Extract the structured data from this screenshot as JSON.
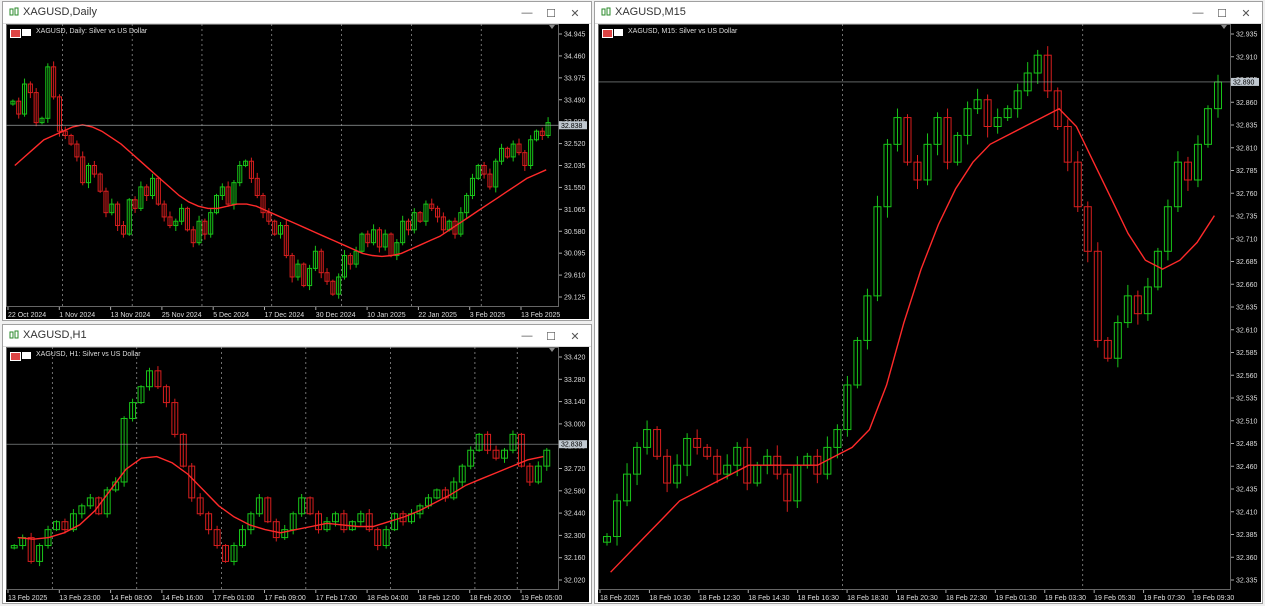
{
  "windows": [
    {
      "id": "daily",
      "title": "XAGUSD,Daily",
      "symbol_label": "XAGUSD, Daily: Silver vs US Dollar",
      "current_price": "32.838",
      "current_value": 32.838,
      "prices": [
        "34.945",
        "34.460",
        "33.975",
        "33.490",
        "33.005",
        "32.520",
        "32.035",
        "31.550",
        "31.065",
        "30.580",
        "30.095",
        "29.610",
        "29.125"
      ],
      "times": [
        "22 Oct 2024",
        "1 Nov 2024",
        "13 Nov 2024",
        "25 Nov 2024",
        "5 Dec 2024",
        "17 Dec 2024",
        "30 Dec 2024",
        "10 Jan 2025",
        "22 Jan 2025",
        "3 Feb 2025",
        "13 Feb 2025"
      ],
      "range": [
        28.6,
        35.2
      ],
      "close": [
        33.4,
        33.1,
        33.8,
        33.6,
        32.9,
        33.0,
        34.2,
        33.5,
        32.7,
        32.6,
        32.4,
        32.1,
        31.5,
        31.9,
        31.7,
        31.3,
        30.8,
        31.0,
        30.5,
        30.3,
        31.1,
        30.9,
        31.4,
        31.2,
        31.6,
        31.0,
        30.7,
        30.5,
        30.6,
        30.9,
        30.4,
        30.1,
        30.6,
        30.3,
        30.8,
        31.2,
        31.4,
        31.0,
        31.5,
        31.9,
        32.0,
        31.6,
        31.2,
        30.8,
        30.6,
        30.3,
        30.5,
        29.8,
        29.3,
        29.6,
        29.1,
        29.5,
        29.9,
        29.4,
        29.2,
        28.9,
        29.3,
        29.8,
        29.6,
        29.9,
        30.3,
        30.1,
        30.4,
        30.0,
        30.3,
        29.8,
        30.1,
        30.6,
        30.4,
        30.8,
        30.6,
        31.0,
        30.9,
        30.7,
        30.4,
        30.6,
        30.3,
        30.8,
        31.2,
        31.6,
        31.9,
        31.7,
        31.4,
        32.0,
        32.3,
        32.1,
        32.4,
        32.2,
        31.9,
        32.5,
        32.7,
        32.6,
        32.9
      ],
      "ma": [
        31.9,
        32.1,
        32.3,
        32.5,
        32.6,
        32.7,
        32.8,
        32.85,
        32.8,
        32.7,
        32.55,
        32.4,
        32.2,
        32.0,
        31.8,
        31.6,
        31.4,
        31.2,
        31.05,
        30.95,
        30.9,
        30.9,
        30.95,
        31.0,
        31.0,
        30.95,
        30.85,
        30.75,
        30.65,
        30.55,
        30.45,
        30.35,
        30.25,
        30.15,
        30.05,
        29.95,
        29.85,
        29.8,
        29.78,
        29.8,
        29.85,
        29.95,
        30.05,
        30.15,
        30.25,
        30.4,
        30.55,
        30.7,
        30.85,
        31.0,
        31.15,
        31.3,
        31.45,
        31.6,
        31.7,
        31.8
      ],
      "months_idx": [
        9,
        21,
        33,
        45,
        57,
        69,
        81
      ]
    },
    {
      "id": "h1",
      "title": "XAGUSD,H1",
      "symbol_label": "XAGUSD, H1: Silver vs US Dollar",
      "current_price": "32.838",
      "current_value": 32.838,
      "prices": [
        "33.420",
        "33.280",
        "33.140",
        "33.000",
        "32.860",
        "32.720",
        "32.580",
        "32.440",
        "32.300",
        "32.160",
        "32.020"
      ],
      "times": [
        "13 Feb 2025",
        "13 Feb 23:00",
        "14 Feb 08:00",
        "14 Feb 16:00",
        "17 Feb 01:00",
        "17 Feb 09:00",
        "17 Feb 17:00",
        "18 Feb 04:00",
        "18 Feb 12:00",
        "18 Feb 20:00",
        "19 Feb 05:00"
      ],
      "range": [
        31.92,
        33.45
      ],
      "close": [
        32.2,
        32.25,
        32.1,
        32.2,
        32.3,
        32.35,
        32.3,
        32.4,
        32.45,
        32.5,
        32.4,
        32.55,
        32.6,
        33.0,
        33.1,
        33.2,
        33.3,
        33.2,
        33.1,
        32.9,
        32.7,
        32.5,
        32.4,
        32.3,
        32.2,
        32.1,
        32.2,
        32.3,
        32.4,
        32.5,
        32.35,
        32.25,
        32.3,
        32.4,
        32.5,
        32.4,
        32.3,
        32.35,
        32.4,
        32.3,
        32.35,
        32.4,
        32.3,
        32.2,
        32.3,
        32.4,
        32.35,
        32.4,
        32.45,
        32.5,
        32.55,
        32.5,
        32.6,
        32.7,
        32.8,
        32.9,
        32.8,
        32.75,
        32.8,
        32.9,
        32.7,
        32.6,
        32.7,
        32.8
      ],
      "ma": [
        32.25,
        32.24,
        32.25,
        32.28,
        32.33,
        32.42,
        32.55,
        32.68,
        32.75,
        32.76,
        32.72,
        32.65,
        32.55,
        32.45,
        32.38,
        32.33,
        32.3,
        32.28,
        32.3,
        32.32,
        32.34,
        32.33,
        32.32,
        32.32,
        32.35,
        32.38,
        32.42,
        32.47,
        32.52,
        32.58,
        32.62,
        32.66,
        32.7,
        32.74,
        32.76
      ],
      "months_idx": [
        5,
        15,
        25,
        35,
        45,
        55,
        60
      ]
    },
    {
      "id": "m15",
      "title": "XAGUSD,M15",
      "symbol_label": "XAGUSD, M15: Silver vs US Dollar",
      "current_price": "32.890",
      "current_value": 32.89,
      "prices": [
        "32.935",
        "32.910",
        "32.885",
        "32.860",
        "32.835",
        "32.810",
        "32.785",
        "32.760",
        "32.735",
        "32.710",
        "32.685",
        "32.660",
        "32.635",
        "32.610",
        "32.585",
        "32.560",
        "32.535",
        "32.510",
        "32.485",
        "32.460",
        "32.435",
        "32.410",
        "32.385",
        "32.360",
        "32.335"
      ],
      "times": [
        "18 Feb 2025",
        "18 Feb 10:30",
        "18 Feb 12:30",
        "18 Feb 14:30",
        "18 Feb 16:30",
        "18 Feb 18:30",
        "18 Feb 20:30",
        "18 Feb 22:30",
        "19 Feb 01:30",
        "19 Feb 03:30",
        "19 Feb 05:30",
        "19 Feb 07:30",
        "19 Feb 09:30"
      ],
      "range": [
        32.32,
        32.955
      ],
      "close": [
        32.38,
        32.42,
        32.45,
        32.48,
        32.5,
        32.47,
        32.44,
        32.46,
        32.49,
        32.48,
        32.47,
        32.45,
        32.46,
        32.48,
        32.44,
        32.46,
        32.47,
        32.45,
        32.42,
        32.46,
        32.47,
        32.45,
        32.48,
        32.5,
        32.55,
        32.6,
        32.65,
        32.75,
        32.82,
        32.85,
        32.8,
        32.78,
        32.82,
        32.85,
        32.8,
        32.83,
        32.86,
        32.87,
        32.84,
        32.85,
        32.86,
        32.88,
        32.9,
        32.92,
        32.88,
        32.84,
        32.8,
        32.75,
        32.7,
        32.6,
        32.58,
        32.62,
        32.65,
        32.63,
        32.66,
        32.7,
        32.75,
        32.8,
        32.78,
        32.82,
        32.86,
        32.89
      ],
      "ma": [
        32.34,
        32.36,
        32.38,
        32.4,
        32.42,
        32.43,
        32.44,
        32.45,
        32.46,
        32.46,
        32.46,
        32.46,
        32.46,
        32.47,
        32.48,
        32.5,
        32.55,
        32.62,
        32.68,
        32.73,
        32.77,
        32.8,
        32.82,
        32.83,
        32.84,
        32.85,
        32.86,
        32.84,
        32.8,
        32.76,
        32.72,
        32.69,
        32.68,
        32.69,
        32.71,
        32.74
      ],
      "months_idx": [
        24,
        48
      ]
    }
  ],
  "controls": {
    "minimize": "—",
    "maximize": "☐",
    "close": "✕"
  }
}
